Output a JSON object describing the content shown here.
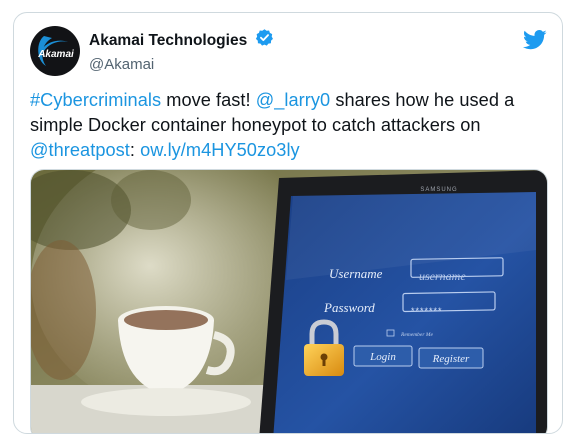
{
  "account": {
    "display_name": "Akamai Technologies",
    "handle": "@Akamai",
    "avatar_text": "Akamai"
  },
  "tweet": {
    "hashtag": "#Cybercriminals",
    "text_1": " move fast! ",
    "mention_1": "@_larry0",
    "text_2": " shares how he used a simple Docker container honeypot to catch attackers on ",
    "mention_2": "@threatpost",
    "text_3": ": ",
    "url": "ow.ly/m4HY50zo3ly"
  },
  "media": {
    "brand": "SAMSUNG",
    "username_label": "Username",
    "username_placeholder": "username",
    "password_label": "Password",
    "password_dots": "*******",
    "remember_label": "Remember Me",
    "login_button": "Login",
    "register_button": "Register"
  },
  "colors": {
    "link": "#1b95e0",
    "twitter_blue": "#1d9bf0",
    "verified": "#1d9bf0",
    "screen_blue": "#1f4f9a",
    "lock_gold": "#f0a526"
  },
  "icons": [
    "verified-badge-icon",
    "twitter-bird-icon",
    "padlock-icon"
  ]
}
